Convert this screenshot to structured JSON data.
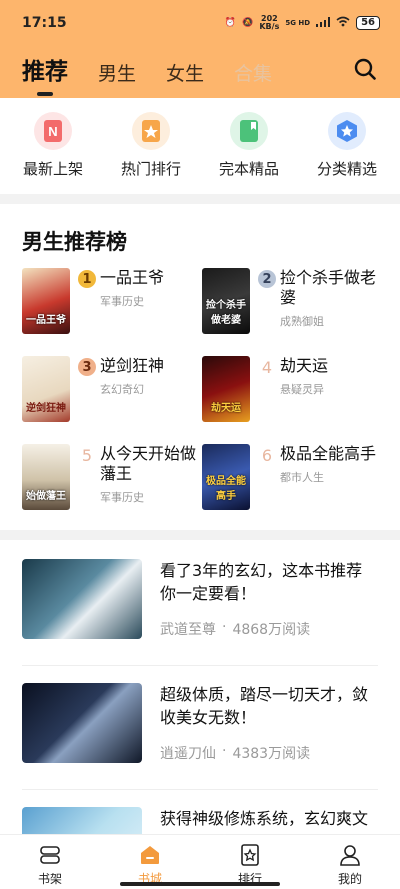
{
  "status": {
    "time": "17:15",
    "speed_value": "202",
    "speed_unit": "KB/s",
    "network": "5G HD",
    "battery": "56"
  },
  "header": {
    "tabs": [
      {
        "label": "推荐",
        "active": true
      },
      {
        "label": "男生"
      },
      {
        "label": "女生"
      },
      {
        "label": "合集"
      }
    ],
    "search_icon": "search-icon"
  },
  "quick": [
    {
      "label": "最新上架",
      "icon": "new-icon",
      "color": "#f36b6b"
    },
    {
      "label": "热门排行",
      "icon": "hot-icon",
      "color": "#f7a64a"
    },
    {
      "label": "完本精品",
      "icon": "book-icon",
      "color": "#4cc27a"
    },
    {
      "label": "分类精选",
      "icon": "category-icon",
      "color": "#4c8cf0"
    }
  ],
  "rank": {
    "title": "男生推荐榜",
    "items": [
      {
        "num": "1",
        "name": "一品王爷",
        "category": "军事历史",
        "cover_text": "一品王爷"
      },
      {
        "num": "2",
        "name": "捡个杀手做老婆",
        "category": "成熟御姐",
        "cover_text": "捡个杀手做老婆"
      },
      {
        "num": "3",
        "name": "逆剑狂神",
        "category": "玄幻奇幻",
        "cover_text": "逆剑狂神"
      },
      {
        "num": "4",
        "name": "劫天运",
        "category": "悬疑灵异",
        "cover_text": "劫天运"
      },
      {
        "num": "5",
        "name": "从今天开始做藩王",
        "category": "军事历史",
        "cover_text": "始做藩王"
      },
      {
        "num": "6",
        "name": "极品全能高手",
        "category": "都市人生",
        "cover_text": "极品全能高手"
      }
    ]
  },
  "feed": [
    {
      "title": "看了3年的玄幻，这本书推荐你一定要看！",
      "book": "武道至尊",
      "reads": "4868万阅读"
    },
    {
      "title": "超级体质，踏尽一切天才，敛收美女无数！",
      "book": "逍遥刀仙",
      "reads": "4383万阅读"
    },
    {
      "title": "获得神级修炼系统，玄幻爽文",
      "book": "",
      "reads": ""
    }
  ],
  "feed_separator": "·",
  "bottom_nav": [
    {
      "label": "书架",
      "icon": "bookshelf-icon"
    },
    {
      "label": "书城",
      "icon": "bookstore-icon",
      "active": true
    },
    {
      "label": "排行",
      "icon": "ranking-icon"
    },
    {
      "label": "我的",
      "icon": "profile-icon"
    }
  ],
  "colors": {
    "header_bg": "#fdb56c",
    "accent": "#f39a3d"
  }
}
